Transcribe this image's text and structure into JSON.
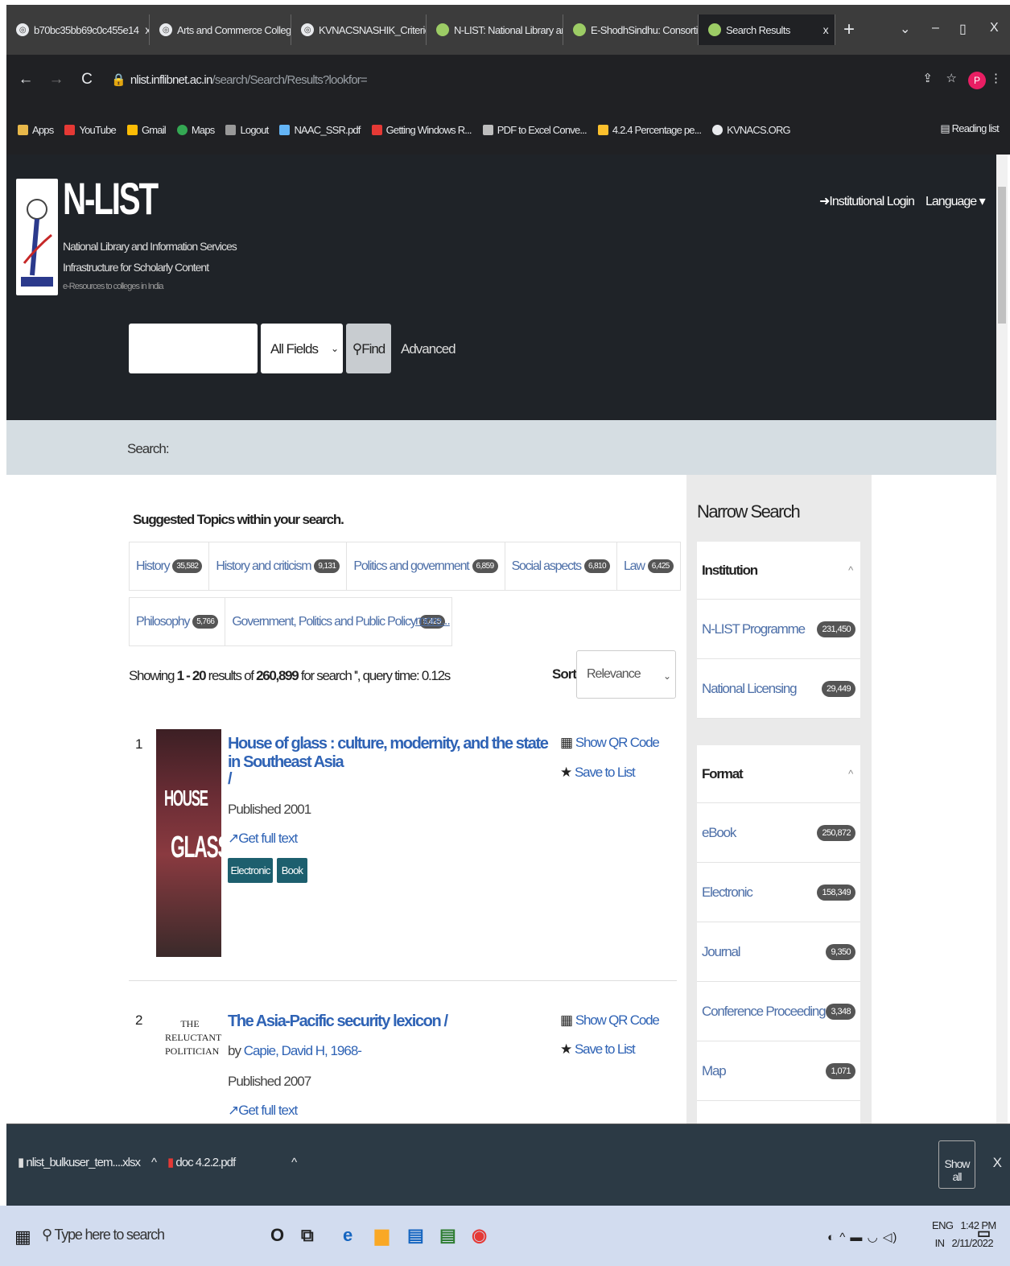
{
  "browser": {
    "tabs": [
      {
        "label": "b70bc35bb69c0c455e14"
      },
      {
        "label": "Arts and Commerce Colleg"
      },
      {
        "label": "KVNACSNASHIK_Criterion"
      },
      {
        "label": "N-LIST: National Library an"
      },
      {
        "label": "E-ShodhSindhu: Consortiu"
      },
      {
        "label": "Search Results"
      }
    ],
    "url_host": "nlist.inflibnet.ac.in",
    "url_path": "/search/Search/Results?lookfor=",
    "profile_initial": "P",
    "bookmarks": [
      {
        "label": "Apps",
        "color": "#e8b84a"
      },
      {
        "label": "YouTube",
        "color": "#e53935"
      },
      {
        "label": "Gmail",
        "color": "#fbbc05"
      },
      {
        "label": "Maps",
        "color": "#34a853"
      },
      {
        "label": "Logout",
        "color": "#999999"
      },
      {
        "label": "NAAC_SSR.pdf",
        "color": "#64b5f6"
      },
      {
        "label": "Getting Windows R...",
        "color": "#e53935"
      },
      {
        "label": "PDF to Excel Conve...",
        "color": "#bdbdbd"
      },
      {
        "label": "4.2.4 Percentage pe...",
        "color": "#fbc02d"
      },
      {
        "label": "KVNACS.ORG",
        "color": "#e8eaed"
      }
    ],
    "reading_list": "Reading list"
  },
  "header": {
    "brand": "N-LIST",
    "line1": "National Library and Information Services",
    "line2": "Infrastructure for Scholarly Content",
    "line3": "e-Resources to colleges in India",
    "institutional_login": "Institutional Login",
    "language": "Language"
  },
  "search": {
    "field": "All Fields",
    "find": "Find",
    "advanced": "Advanced",
    "breadcrumb": "Search:"
  },
  "suggested": {
    "title": "Suggested Topics within your search.",
    "row1": [
      {
        "label": "History",
        "count": "35,582"
      },
      {
        "label": "History and criticism",
        "count": "9,131"
      },
      {
        "label": "Politics and government",
        "count": "6,859"
      },
      {
        "label": "Social aspects",
        "count": "6,810"
      },
      {
        "label": "Law",
        "count": "6,425"
      }
    ],
    "row2": [
      {
        "label": "Philosophy",
        "count": "5,766"
      },
      {
        "label": "Government, Politics and Public Policy",
        "count": "5,425"
      }
    ],
    "more": "more..."
  },
  "results_info": {
    "prefix": "Showing",
    "range": "1 - 20",
    "mid": "results of",
    "total": "260,899",
    "suffix": "for search '', query time: 0.12s",
    "sort_label": "Sort",
    "sort_value": "Relevance"
  },
  "results": [
    {
      "num": "1",
      "title": "House of glass : culture, modernity, and the state in Southeast Asia",
      "title_tail": "/",
      "published": "Published 2001",
      "fulltext": "Get full text",
      "tags": [
        "Electronic",
        "Book"
      ],
      "qr": "Show QR Code",
      "save": "Save to List",
      "cover_line1": "HOUSE",
      "cover_line2": "GLASS"
    },
    {
      "num": "2",
      "title": "The Asia-Pacific security lexicon /",
      "by": "by",
      "author": "Capie, David H, 1968-",
      "published": "Published 2007",
      "fulltext": "Get full text",
      "qr": "Show QR Code",
      "save": "Save to List",
      "cover_line1": "THE",
      "cover_line2": "RELUCTANT",
      "cover_line3": "POLITICIAN"
    }
  ],
  "narrow": {
    "title": "Narrow Search",
    "institution": {
      "heading": "Institution",
      "items": [
        {
          "label": "N-LIST Programme",
          "count": "231,450"
        },
        {
          "label": "National Licensing",
          "count": "29,449"
        }
      ]
    },
    "format": {
      "heading": "Format",
      "items": [
        {
          "label": "eBook",
          "count": "250,872"
        },
        {
          "label": "Electronic",
          "count": "158,349"
        },
        {
          "label": "Journal",
          "count": "9,350"
        },
        {
          "label": "Conference Proceeding",
          "count": "3,348"
        },
        {
          "label": "Map",
          "count": "1,071"
        }
      ]
    }
  },
  "downloads": {
    "items": [
      {
        "label": "nlist_bulkuser_tem....xlsx"
      },
      {
        "label": "doc 4.2.2.pdf"
      }
    ],
    "show_all": "Show all"
  },
  "taskbar": {
    "search_placeholder": "Type here to search",
    "lang1": "ENG",
    "lang2": "IN",
    "time": "1:42 PM",
    "date": "2/11/2022"
  }
}
